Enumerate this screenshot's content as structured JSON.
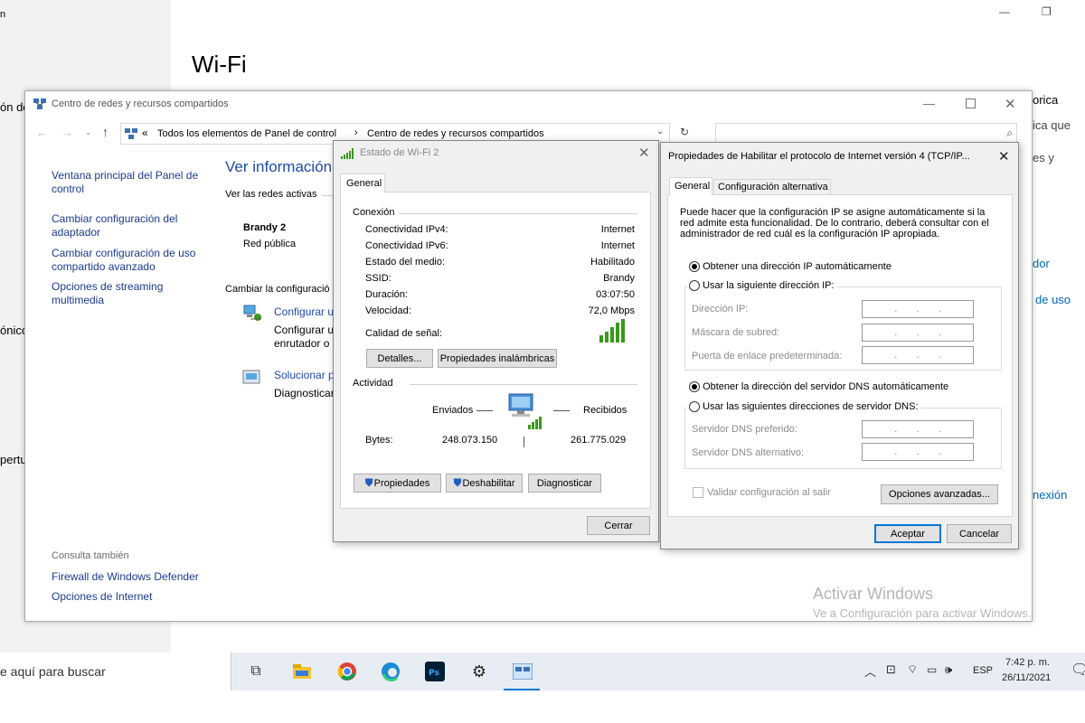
{
  "settings": {
    "title_fragment": "n",
    "heading": "Wi-Fi",
    "left_fragments": [
      "ón de",
      "ónico",
      "pertu"
    ],
    "right_fragments": [
      "orica",
      "ica que",
      "es y",
      "dor",
      "de uso",
      "nexión"
    ],
    "min_symbol": "—",
    "max_symbol": "❐"
  },
  "control_panel": {
    "title": "Centro de redes y recursos compartidos",
    "breadcrumb_chevrons": "«",
    "breadcrumb_1": "Todos los elementos de Panel de control",
    "breadcrumb_sep": "›",
    "breadcrumb_2": "Centro de redes y recursos compartidos",
    "sidebar": {
      "items": [
        "Ventana principal del Panel de control",
        "Cambiar configuración del adaptador",
        "Cambiar configuración de uso compartido avanzado",
        "Opciones de streaming multimedia"
      ],
      "see_also_heading": "Consulta también",
      "see_also": [
        "Firewall de Windows Defender",
        "Opciones de Internet"
      ]
    },
    "main_heading": "Ver información b",
    "active_networks_label": "Ver las redes activas",
    "network_name": "Brandy 2",
    "network_type": "Red pública",
    "change_settings_label": "Cambiar la configuració",
    "task1_link": "Configurar u",
    "task1_desc_1": "Configurar u",
    "task1_desc_2": "enrutador o p",
    "task2_link": "Solucionar pr",
    "task2_desc": "Diagnosticar"
  },
  "wifi_status": {
    "title": "Estado de Wi-Fi 2",
    "tab": "General",
    "connection_group": "Conexión",
    "rows": [
      {
        "label": "Conectividad IPv4:",
        "value": "Internet"
      },
      {
        "label": "Conectividad IPv6:",
        "value": "Internet"
      },
      {
        "label": "Estado del medio:",
        "value": "Habilitado"
      },
      {
        "label": "SSID:",
        "value": "Brandy"
      },
      {
        "label": "Duración:",
        "value": "03:07:50"
      },
      {
        "label": "Velocidad:",
        "value": "72,0 Mbps"
      }
    ],
    "signal_label": "Calidad de señal:",
    "details_button": "Detalles...",
    "wireless_props_button": "Propiedades inalámbricas",
    "activity_group": "Actividad",
    "sent_label": "Enviados",
    "received_label": "Recibidos",
    "bytes_label": "Bytes:",
    "bytes_sent": "248.073.150",
    "bytes_received": "261.775.029",
    "properties_button": "Propiedades",
    "disable_button": "Deshabilitar",
    "diagnose_button": "Diagnosticar",
    "close_button": "Cerrar"
  },
  "tcpip": {
    "title": "Propiedades de Habilitar el protocolo de Internet versión 4 (TCP/IP...",
    "tab_general": "General",
    "tab_alt": "Configuración alternativa",
    "description_lines": [
      "Puede hacer que la configuración IP se asigne automáticamente si la",
      "red admite esta funcionalidad. De lo contrario, deberá consultar con el",
      "administrador de red cuál es la configuración IP apropiada."
    ],
    "radio_auto_ip": "Obtener una dirección IP automáticamente",
    "radio_manual_ip": "Usar la siguiente dirección IP:",
    "ip_label": "Dirección IP:",
    "mask_label": "Máscara de subred:",
    "gateway_label": "Puerta de enlace predeterminada:",
    "radio_auto_dns": "Obtener la dirección del servidor DNS automáticamente",
    "radio_manual_dns": "Usar las siguientes direcciones de servidor DNS:",
    "dns_pref_label": "Servidor DNS preferido:",
    "dns_alt_label": "Servidor DNS alternativo:",
    "validate_label": "Validar configuración al salir",
    "advanced_button": "Opciones avanzadas...",
    "accept_button": "Aceptar",
    "cancel_button": "Cancelar",
    "ip_dots": "."
  },
  "watermark": {
    "line1": "Activar Windows",
    "line2": "Ve a Configuración para activar Windows."
  },
  "taskbar": {
    "search_text": "e aquí para buscar",
    "language": "ESP",
    "time": "7:42 p. m.",
    "date": "26/11/2021"
  },
  "colors": {
    "link": "#1a3a8f",
    "heading": "#1e4aa8",
    "accent": "#0078d7",
    "signal": "#3a9a1a"
  }
}
